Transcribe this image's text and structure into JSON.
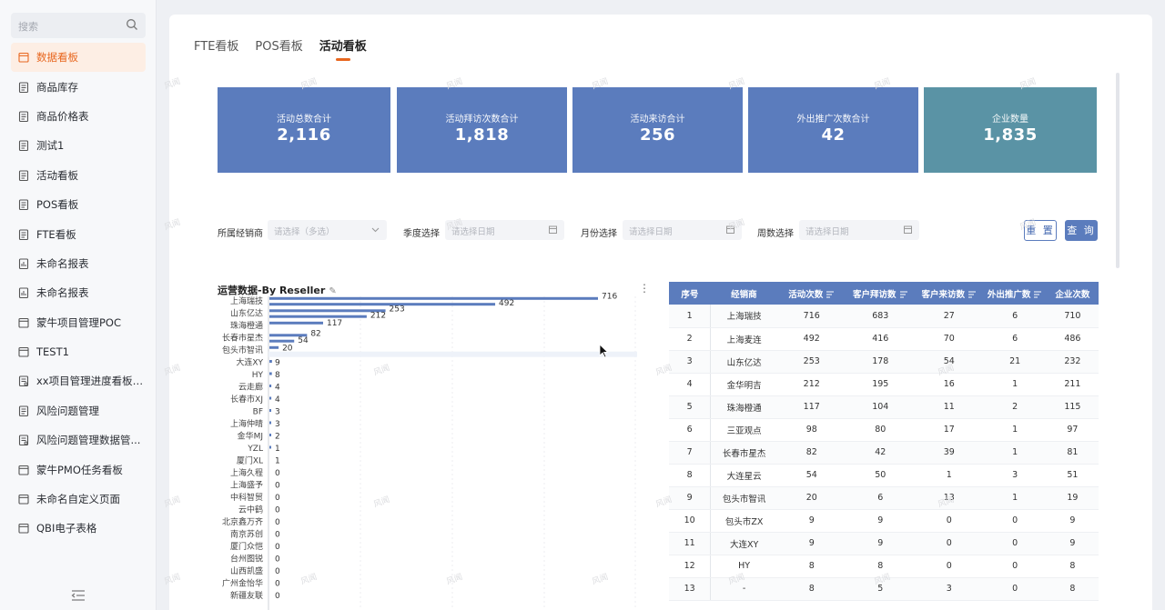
{
  "sidebar": {
    "search_placeholder": "搜索",
    "items": [
      {
        "label": "数据看板",
        "icon": "calendar-icon",
        "active": true
      },
      {
        "label": "商品库存",
        "icon": "doc-icon"
      },
      {
        "label": "商品价格表",
        "icon": "doc-icon"
      },
      {
        "label": "测试1",
        "icon": "doc-icon"
      },
      {
        "label": "活动看板",
        "icon": "doc-icon"
      },
      {
        "label": "POS看板",
        "icon": "doc-icon"
      },
      {
        "label": "FTE看板",
        "icon": "doc-icon"
      },
      {
        "label": "未命名报表",
        "icon": "chart-doc-icon"
      },
      {
        "label": "未命名报表",
        "icon": "chart-doc-icon"
      },
      {
        "label": "蒙牛项目管理POC",
        "icon": "calendar-icon"
      },
      {
        "label": "TEST1",
        "icon": "calendar-icon"
      },
      {
        "label": "xx项目管理进度看板-...",
        "icon": "form-icon"
      },
      {
        "label": "风险问题管理",
        "icon": "doc-icon"
      },
      {
        "label": "风险问题管理数据管...",
        "icon": "form-icon"
      },
      {
        "label": "蒙牛PMO任务看板",
        "icon": "calendar-icon"
      },
      {
        "label": "未命名自定义页面",
        "icon": "calendar-icon"
      },
      {
        "label": "QBI电子表格",
        "icon": "calendar-icon"
      }
    ]
  },
  "tabs": [
    {
      "label": "FTE看板"
    },
    {
      "label": "POS看板"
    },
    {
      "label": "活动看板",
      "active": true
    }
  ],
  "kpis": [
    {
      "label": "活动总数合计",
      "value": "2,116"
    },
    {
      "label": "活动拜访次数合计",
      "value": "1,818"
    },
    {
      "label": "活动来访合计",
      "value": "256"
    },
    {
      "label": "外出推广次数合计",
      "value": "42"
    },
    {
      "label": "企业数量",
      "value": "1,835"
    }
  ],
  "filters": {
    "reseller_label": "所属经销商",
    "reseller_placeholder": "请选择（多选）",
    "quarter_label": "季度选择",
    "quarter_placeholder": "请选择日期",
    "month_label": "月份选择",
    "month_placeholder": "请选择日期",
    "week_label": "周数选择",
    "week_placeholder": "请选择日期",
    "reset": "重 置",
    "query": "查 询"
  },
  "chart_title": "运营数据-By Reseller",
  "chart_data": {
    "type": "bar",
    "orientation": "horizontal",
    "title": "运营数据-By Reseller",
    "categories": [
      "上海瑞技",
      "上海麦连",
      "山东亿达",
      "金华明吉",
      "珠海橙通",
      "三亚观点",
      "长春市星杰",
      "大连星云",
      "包头市智讯",
      "包头市ZX",
      "大连XY",
      "HY",
      "云走廊",
      "长春市XJ",
      "BF",
      "上海仲晴",
      "金华MJ",
      "YZL",
      "厦门XL",
      "上海久程",
      "上海盛予",
      "中科智贸",
      "云中鹤",
      "北京鑫万齐",
      "南京苏创",
      "厦门众恺",
      "台州图锐",
      "山西凯盛",
      "广州金怡华",
      "新疆友联"
    ],
    "series": [
      {
        "values": [
          716,
          683,
          253,
          195,
          117,
          80,
          82,
          54,
          20,
          9,
          9,
          8,
          4,
          4,
          3,
          3,
          2,
          1,
          1,
          0,
          0,
          0,
          0,
          0,
          0,
          0,
          0,
          0,
          0,
          0
        ]
      },
      {
        "values": [
          492,
          416,
          212,
          195,
          117,
          80,
          42,
          50,
          20,
          9,
          9,
          8,
          4,
          4,
          3,
          3,
          2,
          1,
          1,
          0,
          0,
          0,
          0,
          0,
          0,
          0,
          0,
          0,
          0,
          0
        ]
      }
    ],
    "bar_labels": [
      {
        "row": 0,
        "value": 716,
        "series": 0
      },
      {
        "row": 0.7,
        "value": 492,
        "series": 1
      },
      {
        "row": 1,
        "value": 253,
        "series": 0
      },
      {
        "row": 2,
        "value": 212,
        "series": 1
      },
      {
        "row": 2.9,
        "value": 117,
        "series": 0
      },
      {
        "row": 3.6,
        "value": 82,
        "series": 0
      },
      {
        "row": 4,
        "value": 54,
        "series": 1
      },
      {
        "row": 4.6,
        "value": 20,
        "series": 0
      },
      {
        "row": 5,
        "value": 9
      },
      {
        "row": 6,
        "value": 8
      },
      {
        "row": 7,
        "value": 4
      },
      {
        "row": 8,
        "value": 4
      },
      {
        "row": 9,
        "value": 3
      },
      {
        "row": 10,
        "value": 3
      },
      {
        "row": 11,
        "value": 1
      },
      {
        "row": 12,
        "value": 1
      }
    ],
    "axis_labels": [
      "上海瑞技",
      "山东亿达",
      "珠海橙通",
      "长春市星杰",
      "包头市智讯",
      "大连XY",
      "HY",
      "云走廊",
      "长春市XJ",
      "BF",
      "上海仲晴",
      "金华MJ",
      "YZL",
      "厦门XL",
      "上海久程",
      "上海盛予",
      "中科智贸",
      "云中鹤",
      "北京鑫万齐",
      "南京苏创",
      "厦门众恺",
      "台州图锐",
      "山西凯盛",
      "广州金怡华",
      "新疆友联"
    ],
    "axis_values": [
      "716",
      "253",
      "117",
      "82",
      "20",
      "9",
      "8",
      "4",
      "4",
      "3",
      "3",
      "2",
      "1",
      "1",
      "0",
      "0",
      "0",
      "0",
      "0",
      "0",
      "0",
      "0",
      "0",
      "0",
      "0"
    ],
    "xlim": [
      0,
      716
    ]
  },
  "table": {
    "headers": [
      "序号",
      "经销商",
      "活动次数",
      "客户拜访数",
      "客户来访数",
      "外出推广数",
      "企业次数"
    ],
    "rows": [
      [
        "1",
        "上海瑞技",
        "716",
        "683",
        "27",
        "6",
        "710"
      ],
      [
        "2",
        "上海麦连",
        "492",
        "416",
        "70",
        "6",
        "486"
      ],
      [
        "3",
        "山东亿达",
        "253",
        "178",
        "54",
        "21",
        "232"
      ],
      [
        "4",
        "金华明吉",
        "212",
        "195",
        "16",
        "1",
        "211"
      ],
      [
        "5",
        "珠海橙通",
        "117",
        "104",
        "11",
        "2",
        "115"
      ],
      [
        "6",
        "三亚观点",
        "98",
        "80",
        "17",
        "1",
        "97"
      ],
      [
        "7",
        "长春市星杰",
        "82",
        "42",
        "39",
        "1",
        "81"
      ],
      [
        "8",
        "大连星云",
        "54",
        "50",
        "1",
        "3",
        "51"
      ],
      [
        "9",
        "包头市智讯",
        "20",
        "6",
        "13",
        "1",
        "19"
      ],
      [
        "10",
        "包头市ZX",
        "9",
        "9",
        "0",
        "0",
        "9"
      ],
      [
        "11",
        "大连XY",
        "9",
        "9",
        "0",
        "0",
        "9"
      ],
      [
        "12",
        "HY",
        "8",
        "8",
        "0",
        "0",
        "8"
      ],
      [
        "13",
        "-",
        "8",
        "5",
        "3",
        "0",
        "8"
      ]
    ]
  },
  "colors": {
    "accent": "#e8671f",
    "primary": "#5b7cbd",
    "teal": "#5a93a5"
  }
}
